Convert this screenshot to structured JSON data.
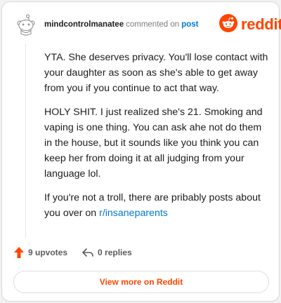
{
  "header": {
    "username": "mindcontrolmanatee",
    "verb": "commented on",
    "post_link": "post",
    "brand": "reddit"
  },
  "comment": {
    "paragraphs": [
      "YTA. She deserves privacy. You'll lose contact with your daughter as soon as she's able to get away from you if you continue to act that way.",
      "HOLY SHIT. I just realized she's 21. Smoking and vaping is one thing. You can ask ahe not do them in the house, but it sounds like you think you can keep her from doing it at all judging from your language lol."
    ],
    "last_paragraph_text": "If you're not a troll, there are pribably posts about you over on ",
    "link_text": "r/insaneparents"
  },
  "actions": {
    "upvotes": "9 upvotes",
    "replies": "0 replies"
  },
  "cta": {
    "label": "View more on Reddit"
  },
  "colors": {
    "brand": "#ff4500",
    "link": "#0079d3",
    "text": "#1c1c1c",
    "muted": "#7c7c7c"
  },
  "icons": {
    "avatar": "snoo-avatar-icon",
    "logo": "reddit-logo-icon",
    "upvote": "upvote-arrow-icon",
    "reply": "reply-arrow-icon"
  }
}
